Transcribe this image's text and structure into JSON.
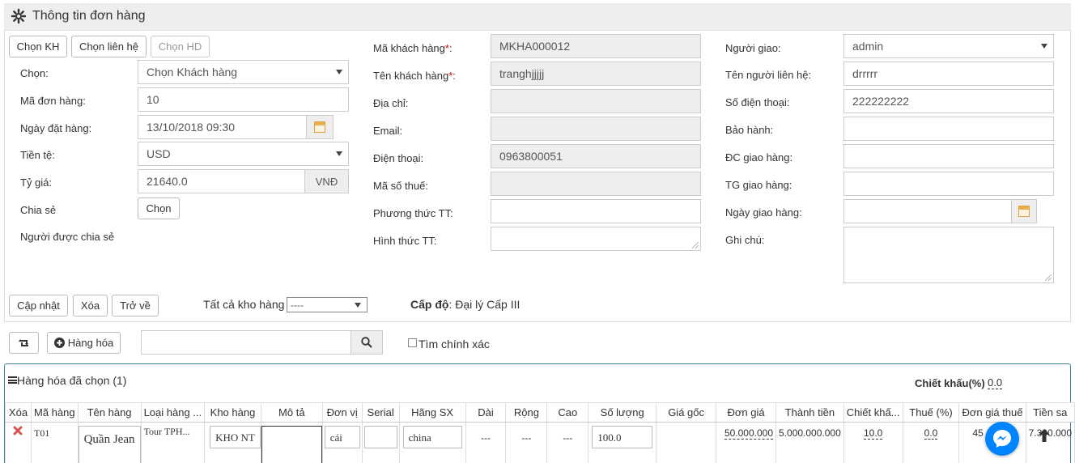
{
  "header": {
    "title": "Thông tin đơn hàng"
  },
  "top_buttons": {
    "choose_customer": "Chọn KH",
    "choose_contact": "Chọn liên hệ",
    "choose_order": "Chọn HD"
  },
  "form_left": {
    "chon_label": "Chọn:",
    "chon_value": "Chọn Khách hàng",
    "order_code_label": "Mã đơn hàng:",
    "order_code_value": "10",
    "order_date_label": "Ngày đặt hàng:",
    "order_date_value": "13/10/2018 09:30",
    "currency_label": "Tiền tệ:",
    "currency_value": "USD",
    "rate_label": "Tỷ giá:",
    "rate_value": "21640.0",
    "rate_unit": "VNĐ",
    "share_label": "Chia sẻ",
    "share_button": "Chọn",
    "shared_with_label": "Người được chia sẻ"
  },
  "form_mid": {
    "customer_code_label": "Mã khách hàng",
    "customer_code_value": "MKHA000012",
    "customer_name_label": "Tên khách hàng",
    "customer_name_value": "tranghjjjjj",
    "address_label": "Địa chỉ:",
    "address_value": "",
    "email_label": "Email:",
    "email_value": "",
    "phone_label": "Điện thoại:",
    "phone_value": "0963800051",
    "tax_label": "Mã số thuế:",
    "tax_value": "",
    "pay_method_label": "Phương thức TT:",
    "pay_form_label": "Hình thức TT:"
  },
  "form_right": {
    "deliverer_label": "Người giao:",
    "deliverer_value": "admin",
    "contact_label": "Tên người liên hệ:",
    "contact_value": "drrrrr",
    "phone_label": "Số điện thoại:",
    "phone_value": "222222222",
    "warranty_label": "Bảo hành:",
    "delivery_addr_label": "ĐC giao hàng:",
    "delivery_time_label": "TG giao hàng:",
    "delivery_date_label": "Ngày giao hàng:",
    "note_label": "Ghi chú:"
  },
  "actions": {
    "update": "Cập nhật",
    "delete": "Xóa",
    "back": "Trở về",
    "warehouse_label": "Tất cả kho hàng",
    "warehouse_value": "----",
    "level_label": "Cấp độ",
    "level_value": ": Đại lý Cấp III"
  },
  "toolbar": {
    "add_goods": "Hàng hóa",
    "exact_search": "Tìm chính xác",
    "search_value": ""
  },
  "cart": {
    "title": "Hàng hóa đã chọn (1)",
    "discount_label": "Chiết khấu(%)",
    "discount_value": "0.0",
    "columns": [
      "Xóa",
      "Mã hàng",
      "Tên hàng",
      "Loại hàng ...",
      "Kho hàng",
      "Mô tả",
      "Đơn vị",
      "Serial",
      "Hãng SX",
      "Dài",
      "Rộng",
      "Cao",
      "Số lượng",
      "Giá gốc",
      "Đơn giá",
      "Thành tiền",
      "Chiết khấ...",
      "Thuế (%)",
      "Đơn giá thuế",
      "Tiền sa"
    ],
    "row": {
      "code": "T01",
      "name": "Quần Jean",
      "type": "Tour TPH...",
      "warehouse": "KHO NT",
      "description": "",
      "unit": "cái",
      "serial": "",
      "maker": "china",
      "length": "---",
      "width": "---",
      "height": "---",
      "quantity": "100.0",
      "base_price": "",
      "unit_price": "50.000.000",
      "total": "5.000.000.000",
      "discount": "10.0",
      "tax": "0.0",
      "taxed_price": "45",
      "after": "7.300.000"
    }
  },
  "colors": {
    "accent": "#3a87ad",
    "required": "#dd0000",
    "messenger": "#0084ff"
  }
}
